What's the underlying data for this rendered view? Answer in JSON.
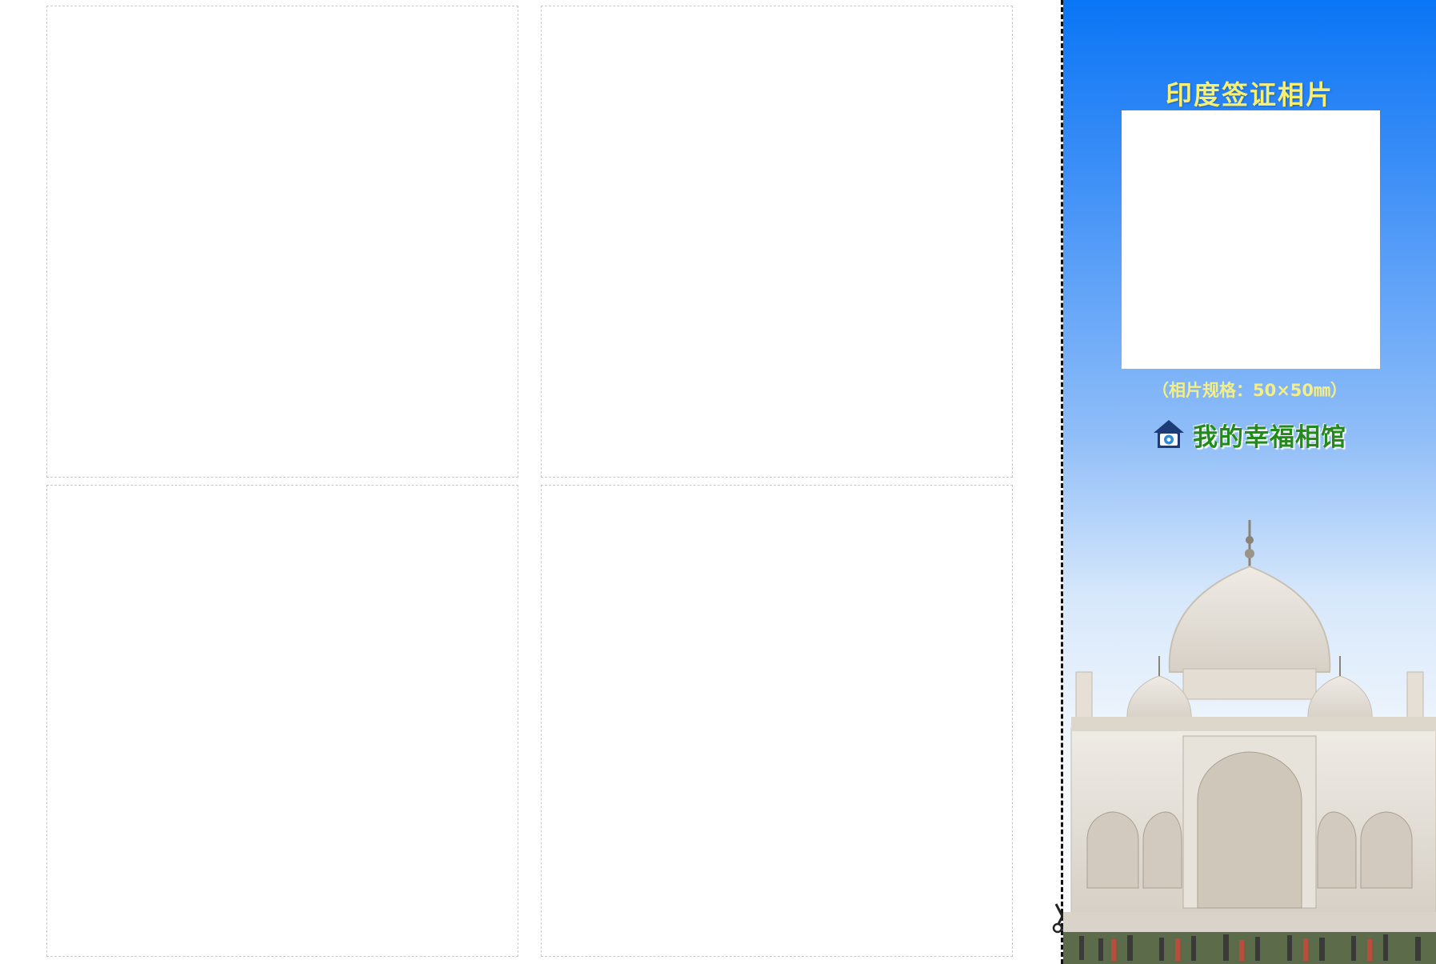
{
  "print_sheet": {
    "photo_slots": [
      "",
      "",
      "",
      ""
    ]
  },
  "panel": {
    "title": "印度签证相片",
    "spec": "（相片规格：50×50㎜）",
    "brand_name": "我的幸福相馆",
    "brand_icon": "camera-house-icon",
    "landmark_image": "taj-mahal-image",
    "cut_icon": "scissors-icon"
  },
  "colors": {
    "panel_top": "#0a75f5",
    "panel_bottom": "#ffffff",
    "title_color": "#f6ef72",
    "spec_color": "#f4ee86",
    "brand_color": "#238a1c",
    "slot_border": "#c9c9c9"
  }
}
